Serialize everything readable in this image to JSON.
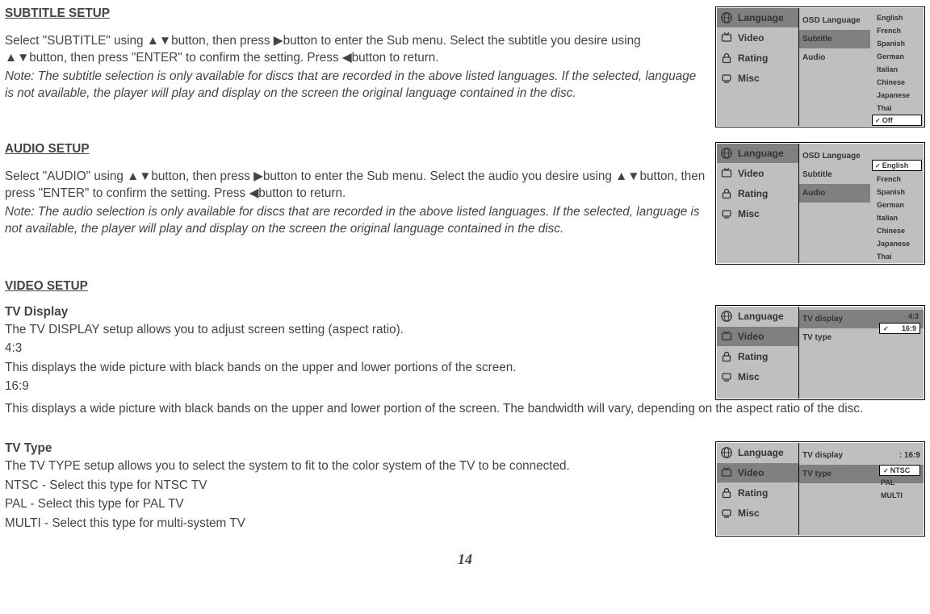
{
  "page_number": "14",
  "sections": {
    "subtitle": {
      "heading": "SUBTITLE SETUP",
      "p1a": "Select \"SUBTITLE\" using ",
      "p1b": "button, then press ",
      "p1c": "button to enter the Sub menu. Select the subtitle you desire using ",
      "p1d": "button, then press \"ENTER\" to confirm the setting. Press ",
      "p1e": "button to return.",
      "note": "Note: The subtitle selection is only available for discs that are recorded in the above listed languages. If the selected, language is not available, the player will play and display on the screen the original language contained in the disc."
    },
    "audio": {
      "heading": "AUDIO SETUP",
      "p1a": "Select \"AUDIO\" using ",
      "p1b": "button, then press ",
      "p1c": "button to enter the Sub menu. Select the audio you desire using ",
      "p1d": "button, then press \"ENTER\" to confirm the setting. Press ",
      "p1e": "button to return.",
      "note": "Note: The audio selection is only available for discs that are recorded in the above listed languages. If the selected, language is not available, the player will play and display on the screen the original language contained in the disc."
    },
    "video": {
      "heading": "VIDEO SETUP",
      "tv_display": {
        "sub": "TV Display",
        "l1": "The TV DISPLAY setup allows you to adjust screen setting (aspect ratio).",
        "l2": "4:3",
        "l3": "This displays the wide picture with black bands on the upper and lower portions of the screen.",
        "l4": "16:9",
        "l5": "This displays a wide picture with black bands on the upper and lower portion of the screen. The bandwidth will vary, depending on the aspect ratio of the disc."
      },
      "tv_type": {
        "sub": "TV Type",
        "l1": "The TV TYPE setup allows you to select the system to fit to the color system of the TV to be connected.",
        "l2": "NTSC - Select this type for NTSC TV",
        "l3": "PAL - Select this type for PAL TV",
        "l4": "MULTI - Select this type for multi-system TV"
      }
    }
  },
  "osd": {
    "cats": {
      "language": "Language",
      "video": "Video",
      "rating": "Rating",
      "misc": "Misc"
    },
    "sub_labels": {
      "osd_language": "OSD Language",
      "subtitle": "Subtitle",
      "audio": "Audio",
      "tv_display": "TV display",
      "tv_type": "TV type"
    },
    "langs": {
      "english": "English",
      "french": "French",
      "spanish": "Spanish",
      "german": "German",
      "italian": "Italian",
      "chinese": "Chinese",
      "japanese": "Japanese",
      "thai": "Thai",
      "off": "Off"
    },
    "check": "✓",
    "tv_display_vals": {
      "v43": "4:3",
      "v169": "16:9",
      "curr169": ": 16:9"
    },
    "tv_types": {
      "ntsc": "NTSC",
      "pal": "PAL",
      "multi": "MULTI"
    }
  }
}
